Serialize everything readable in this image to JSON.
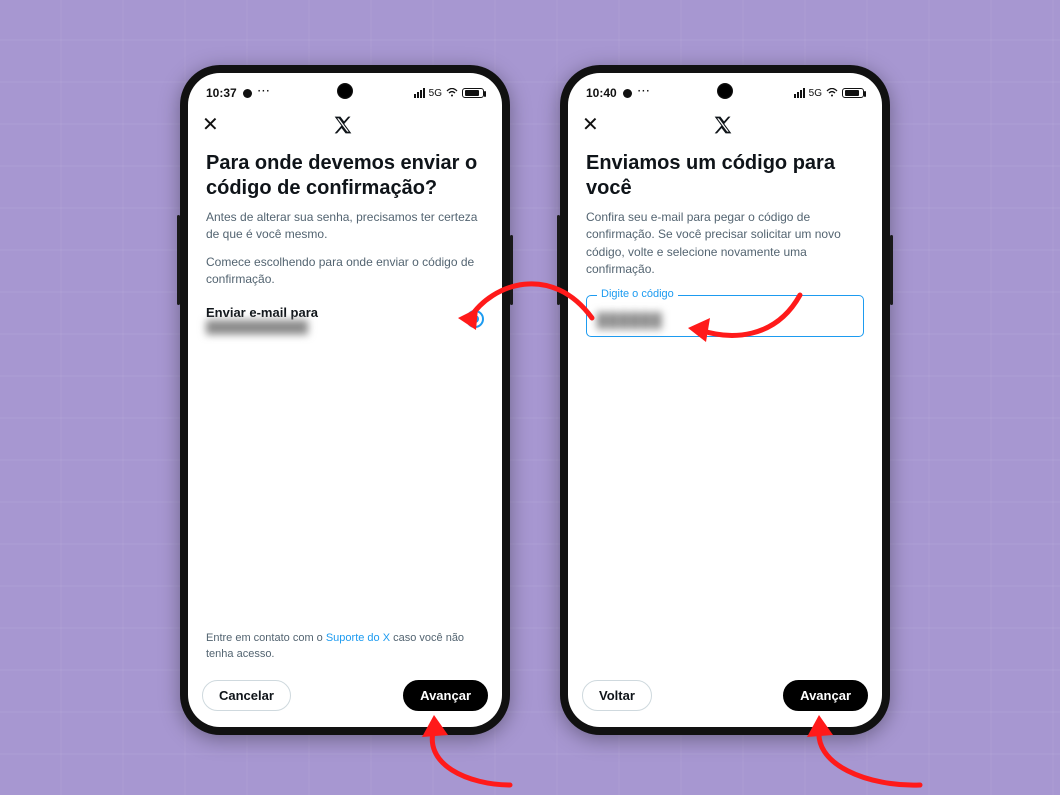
{
  "phone1": {
    "status": {
      "time": "10:37",
      "dots": "···",
      "net": "5G"
    },
    "title": "Para onde devemos enviar o código de confirmação?",
    "para1": "Antes de alterar sua senha, precisamos ter certeza de que é você mesmo.",
    "para2": "Comece escolhendo para onde enviar o código de confirmação.",
    "radio_label": "Enviar e-mail para",
    "radio_sub": "████████████",
    "support_pre": "Entre em contato com o ",
    "support_link": "Suporte do X",
    "support_post": " caso você não tenha acesso.",
    "btn_cancel": "Cancelar",
    "btn_next": "Avançar"
  },
  "phone2": {
    "status": {
      "time": "10:40",
      "dots": "···",
      "net": "5G"
    },
    "title": "Enviamos um código para você",
    "para1": "Confira seu e-mail para pegar o código de confirmação. Se você precisar solicitar um novo código, volte e selecione novamente uma confirmação.",
    "field_legend": "Digite o código",
    "field_value": "██████",
    "btn_back": "Voltar",
    "btn_next": "Avançar"
  }
}
